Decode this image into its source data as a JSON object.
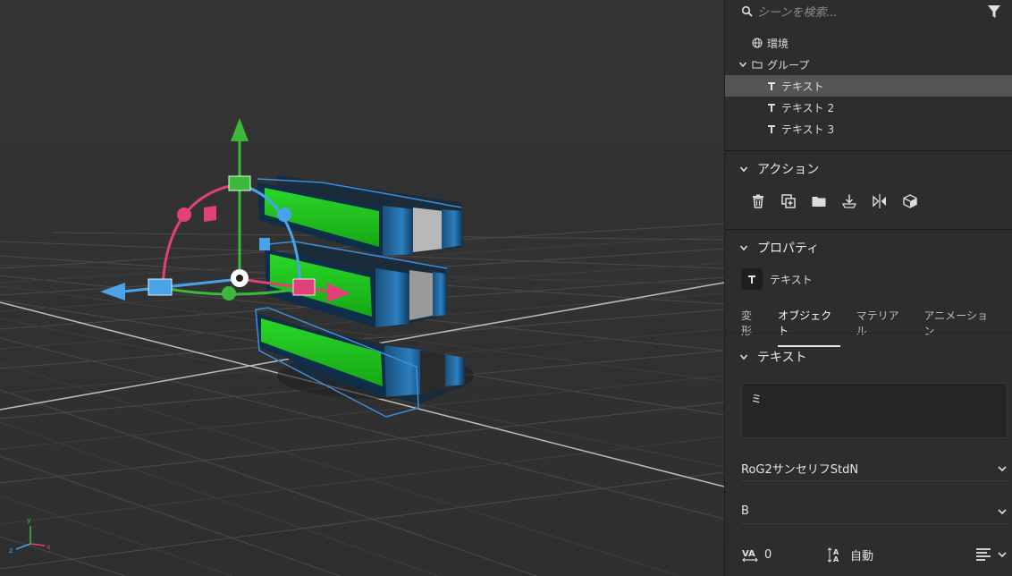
{
  "search": {
    "placeholder": "シーンを検索..."
  },
  "scene_tree": [
    {
      "label": "環境",
      "icon": "globe-icon",
      "level": 0,
      "selected": false
    },
    {
      "label": "グループ",
      "icon": "folder-icon",
      "level": 0,
      "expanded": true,
      "selected": false
    },
    {
      "label": "テキスト",
      "icon": "text-object-icon",
      "level": 1,
      "selected": true
    },
    {
      "label": "テキスト 2",
      "icon": "text-object-icon",
      "level": 1,
      "selected": false
    },
    {
      "label": "テキスト 3",
      "icon": "text-object-icon",
      "level": 1,
      "selected": false
    }
  ],
  "actions_section": {
    "title": "アクション",
    "buttons": [
      "trash-icon",
      "duplicate-icon",
      "folder-icon",
      "download-icon",
      "mirror-icon",
      "cube-icon"
    ]
  },
  "properties_section": {
    "title": "プロパティ",
    "object_label": "テキスト",
    "tabs": [
      "変形",
      "オブジェクト",
      "マテリアル",
      "アニメーション"
    ],
    "active_tab": "オブジェクト"
  },
  "text_section": {
    "title": "テキスト",
    "content": "ミ",
    "font_family": "RoG2サンセリフStdN",
    "font_weight": "B",
    "tracking": "0",
    "leading": "自動"
  },
  "colors": {
    "gizmo_y": "#3cb83c",
    "gizmo_x": "#e0417a",
    "gizmo_z": "#4aa3e8",
    "text_face": "#22c41e",
    "text_side": "#1d5a8c"
  },
  "axis_indicator": {
    "x": "x",
    "y": "y",
    "z": "z"
  }
}
